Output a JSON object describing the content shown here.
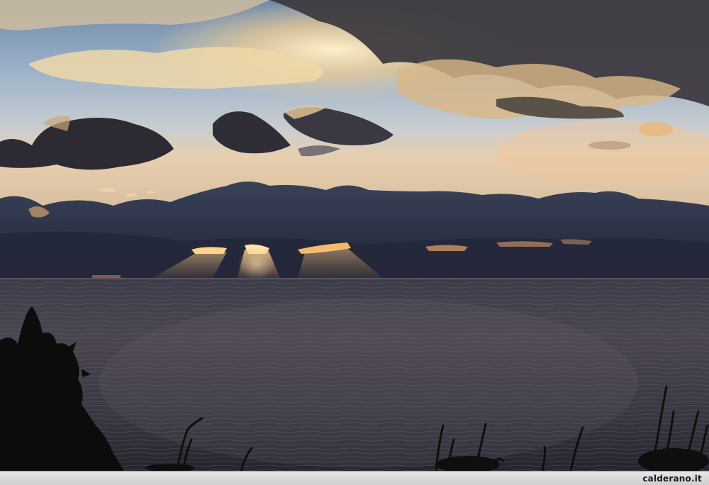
{
  "photo": {
    "subject": "sunset-over-sea",
    "colors": {
      "sky_top": "#8aa6c4",
      "sky_horizon": "#dcc6a8",
      "cloud_dark": "#2a2e3c",
      "cloud_glow": "#f2c27a",
      "sea": "#2b2a33",
      "vegetation": "#0b0d0c"
    }
  },
  "watermark": {
    "text": "calderano.it"
  }
}
